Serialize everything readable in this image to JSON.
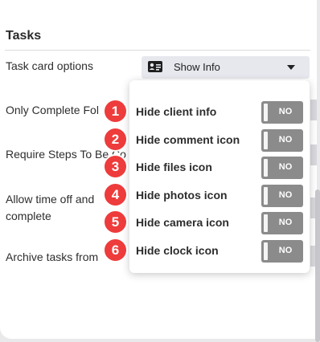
{
  "section": {
    "title": "Tasks"
  },
  "task_card_options": {
    "label": "Task card options",
    "dropdown_value": "Show Info",
    "dropdown_icon": "id-card-icon"
  },
  "settings_rows": [
    {
      "label": "Only Complete Fol"
    },
    {
      "label": "Require Steps To Be Co"
    },
    {
      "label_line1": "Allow time off and",
      "label_line2": "complete"
    },
    {
      "label": "Archive tasks from"
    }
  ],
  "menu": {
    "items": [
      {
        "label": "Hide client info",
        "toggle": "NO",
        "badge": "1"
      },
      {
        "label": "Hide comment icon",
        "toggle": "NO",
        "badge": "2"
      },
      {
        "label": "Hide files icon",
        "toggle": "NO",
        "badge": "3"
      },
      {
        "label": "Hide photos icon",
        "toggle": "NO",
        "badge": "4"
      },
      {
        "label": "Hide camera icon",
        "toggle": "NO",
        "badge": "5"
      },
      {
        "label": "Hide clock icon",
        "toggle": "NO",
        "badge": "6"
      }
    ]
  },
  "colors": {
    "badge": "#ee3b3b",
    "toggle_off": "#8b8b8b",
    "dropdown_bg": "#e7e8ee"
  }
}
